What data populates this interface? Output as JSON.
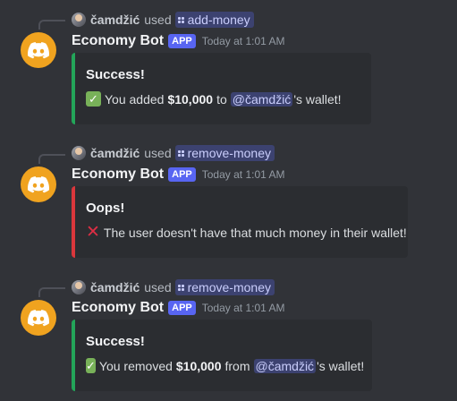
{
  "colors": {
    "background": "#313338",
    "embed_bg": "#2b2d31",
    "success_bar": "#23a559",
    "error_bar": "#da373c",
    "app_tag": "#5865f2",
    "mention_bg": "#3c4270",
    "bot_avatar": "#f0a31f"
  },
  "messages": [
    {
      "reply": {
        "user": "čamdžić",
        "used": "used",
        "command": "add-money"
      },
      "bot": {
        "name": "Economy Bot",
        "tag": "APP",
        "time": "Today at 1:01 AM"
      },
      "embed": {
        "status": "success",
        "title": "Success!",
        "icon": "check-mark-emoji",
        "pre": "You added",
        "amount": "$10,000",
        "mid": "to",
        "mention": "@čamdžić",
        "post": "'s wallet!"
      }
    },
    {
      "reply": {
        "user": "čamdžić",
        "used": "used",
        "command": "remove-money"
      },
      "bot": {
        "name": "Economy Bot",
        "tag": "APP",
        "time": "Today at 1:01 AM"
      },
      "embed": {
        "status": "error",
        "title": "Oops!",
        "icon": "cross-mark-emoji",
        "text": "The user doesn't have that much money in their wallet!"
      }
    },
    {
      "reply": {
        "user": "čamdžić",
        "used": "used",
        "command": "remove-money"
      },
      "bot": {
        "name": "Economy Bot",
        "tag": "APP",
        "time": "Today at 1:01 AM"
      },
      "embed": {
        "status": "success",
        "title": "Success!",
        "icon": "check-mark-emoji",
        "pre": "You removed",
        "amount": "$10,000",
        "mid": "from",
        "mention": "@čamdžić",
        "post": "'s wallet!"
      }
    }
  ]
}
